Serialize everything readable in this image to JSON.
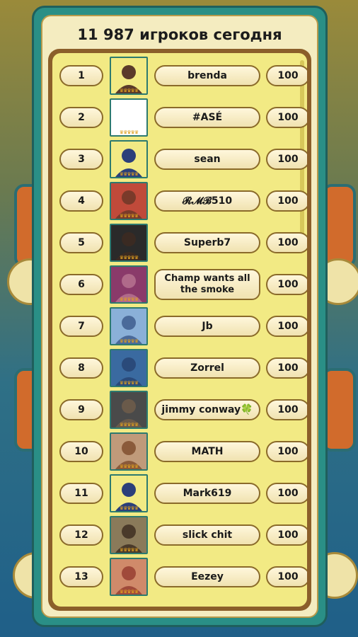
{
  "title": "11 987 игроков сегодня",
  "colors": {
    "panel": "#2a8f86",
    "list_bg": "#f2ea84",
    "frame": "#8b5f2a",
    "pill_border": "#8a6a2a"
  },
  "crowns": "♛♛♛♛♛",
  "players": [
    {
      "rank": "1",
      "name": "brenda",
      "score": "100",
      "avatar_color": "#5a3a2a",
      "avatar_bg": "#f2ea84"
    },
    {
      "rank": "2",
      "name": "#ASÉ",
      "score": "100",
      "avatar_color": "#ffffff",
      "avatar_bg": "#ffffff"
    },
    {
      "rank": "3",
      "name": "sean",
      "score": "100",
      "avatar_color": "#2b3f7a",
      "avatar_bg": "#f2ea84"
    },
    {
      "rank": "4",
      "name": "𝓡𝓜𝓑510",
      "score": "100",
      "avatar_color": "#7a3a2a",
      "avatar_bg": "#c04a3a"
    },
    {
      "rank": "5",
      "name": "Superb7",
      "score": "100",
      "avatar_color": "#3a2a22",
      "avatar_bg": "#2a2a2a"
    },
    {
      "rank": "6",
      "name": "Champ wants all the smoke",
      "score": "100",
      "avatar_color": "#b06a8a",
      "avatar_bg": "#8a3a6a"
    },
    {
      "rank": "7",
      "name": "Jb",
      "score": "100",
      "avatar_color": "#4a6a9a",
      "avatar_bg": "#8ab0d8"
    },
    {
      "rank": "8",
      "name": "Zorrel",
      "score": "100",
      "avatar_color": "#2a4a7a",
      "avatar_bg": "#3a6aa0"
    },
    {
      "rank": "9",
      "name": "jimmy conway🍀",
      "score": "100",
      "avatar_color": "#6a5a4a",
      "avatar_bg": "#4a4a4a"
    },
    {
      "rank": "10",
      "name": "MATH",
      "score": "100",
      "avatar_color": "#8a5a3a",
      "avatar_bg": "#c09a7a"
    },
    {
      "rank": "11",
      "name": "Mark619",
      "score": "100",
      "avatar_color": "#2b3f7a",
      "avatar_bg": "#f2ea84"
    },
    {
      "rank": "12",
      "name": "slick chit",
      "score": "100",
      "avatar_color": "#4a3a2a",
      "avatar_bg": "#8a7a5a"
    },
    {
      "rank": "13",
      "name": "Eezey",
      "score": "100",
      "avatar_color": "#a04a3a",
      "avatar_bg": "#d08a6a"
    }
  ]
}
